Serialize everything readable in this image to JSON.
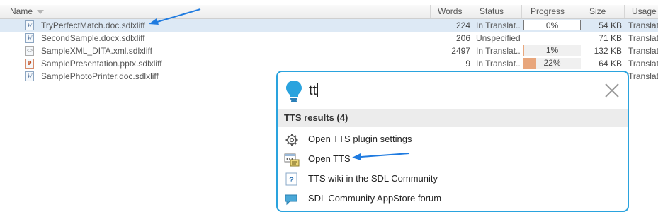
{
  "columns": {
    "name": "Name",
    "words": "Words",
    "status": "Status",
    "progress": "Progress",
    "size": "Size",
    "usage": "Usage"
  },
  "files": [
    {
      "icon": "word-doc-icon",
      "name": "TryPerfectMatch.doc.sdlxliff",
      "words": "224",
      "status": "In Translat...",
      "progress_label": "0%",
      "progress": 0,
      "size": "54 KB",
      "usage": "Translat",
      "selected": true
    },
    {
      "icon": "word-doc-icon",
      "name": "SecondSample.docx.sdlxliff",
      "words": "206",
      "status": "Unspecified",
      "progress_label": "",
      "progress": null,
      "size": "71 KB",
      "usage": "Translat"
    },
    {
      "icon": "xml-doc-icon",
      "name": "SampleXML_DITA.xml.sdlxliff",
      "words": "2497",
      "status": "In Translat...",
      "progress_label": "1%",
      "progress": 1,
      "size": "132 KB",
      "usage": "Translat"
    },
    {
      "icon": "powerpoint-doc-icon",
      "name": "SamplePresentation.pptx.sdlxliff",
      "words": "9",
      "status": "In Translat...",
      "progress_label": "22%",
      "progress": 22,
      "size": "64 KB",
      "usage": "Translat"
    },
    {
      "icon": "word-doc-icon",
      "name": "SamplePhotoPrinter.doc.sdlxliff",
      "words": "",
      "status": "",
      "progress_label": "",
      "progress": null,
      "size": "",
      "usage": "Translat"
    }
  ],
  "search": {
    "query": "tt",
    "results_header": "TTS results (4)",
    "results": [
      {
        "icon": "gear-icon",
        "label": "Open TTS plugin settings"
      },
      {
        "icon": "tts-window-icon",
        "label": "Open TTS"
      },
      {
        "icon": "help-question-icon",
        "label": "TTS wiki in the SDL Community"
      },
      {
        "icon": "forum-chat-icon",
        "label": "SDL Community AppStore forum"
      }
    ]
  },
  "colors": {
    "accent": "#2aa3de",
    "arrow": "#1f7be0",
    "progress_fill": "#e8a67c",
    "selected_row": "#dde9f5"
  }
}
